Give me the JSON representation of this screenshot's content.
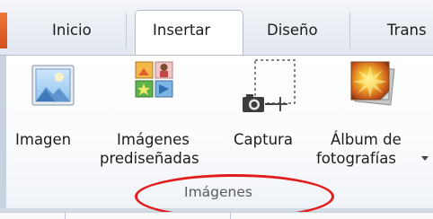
{
  "tabs": [
    {
      "label": "Inicio",
      "active": false
    },
    {
      "label": "Insertar",
      "active": true
    },
    {
      "label": "Diseño",
      "active": false
    },
    {
      "label": "Trans",
      "active": false
    }
  ],
  "group": {
    "label": "Imágenes",
    "buttons": [
      {
        "label_lines": [
          "Imagen"
        ],
        "icon": "picture-icon",
        "dropdown": false
      },
      {
        "label_lines": [
          "Imágenes",
          "prediseñadas"
        ],
        "icon": "clip-art-icon",
        "dropdown": false
      },
      {
        "label_lines": [
          "Captura"
        ],
        "icon": "screenshot-icon",
        "dropdown": false
      },
      {
        "label_lines": [
          "Álbum de",
          "fotografías"
        ],
        "icon": "photo-album-icon",
        "dropdown": true
      }
    ]
  },
  "annotation": {
    "shape": "ellipse",
    "color": "#e21b1b"
  },
  "colors": {
    "accent_orange": "#f0783a",
    "ribbon_border": "#b6bdc7"
  }
}
